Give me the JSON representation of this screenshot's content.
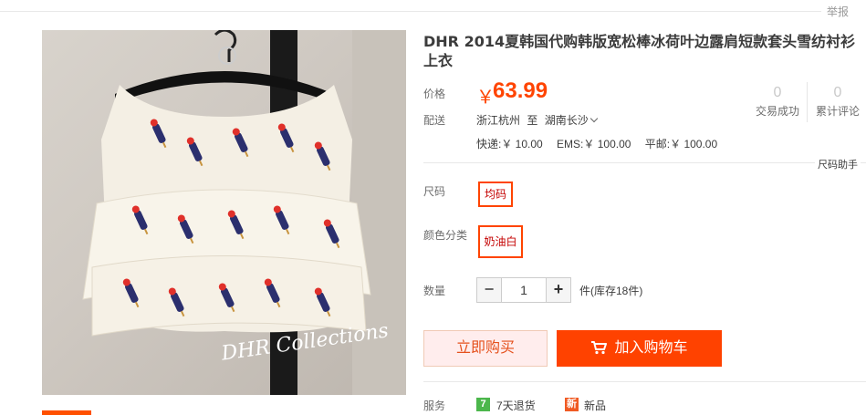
{
  "header": {
    "report_label": "举报"
  },
  "product": {
    "title": "DHR 2014夏韩国代购韩版宽松棒冰荷叶边露肩短款套头雪纺衬衫上衣",
    "image_logo_text": "DHR Collections"
  },
  "price": {
    "label": "价格",
    "symbol": "￥",
    "value": "63.99"
  },
  "stats": [
    {
      "count": "0",
      "label": "交易成功"
    },
    {
      "count": "0",
      "label": "累计评论"
    }
  ],
  "shipping": {
    "label": "配送",
    "from": "浙江杭州",
    "to_word": "至",
    "to": "湖南长沙",
    "fees": [
      "快递:￥ 10.00",
      "EMS:￥ 100.00",
      "平邮:￥ 100.00"
    ]
  },
  "size_help": "尺码助手",
  "size": {
    "label": "尺码",
    "selected": "均码"
  },
  "color": {
    "label": "颜色分类",
    "selected": "奶油白"
  },
  "quantity": {
    "label": "数量",
    "minus": "−",
    "value": "1",
    "plus": "+",
    "stock": "件(库存18件)"
  },
  "actions": {
    "buy_now": "立即购买",
    "add_to_cart": "加入购物车"
  },
  "services": {
    "label": "服务",
    "items": [
      {
        "badge": "7",
        "text": "7天退货",
        "color": "#4cb74c"
      },
      {
        "badge": "新",
        "text": "新品",
        "color": "#f05a23"
      }
    ]
  },
  "colors": {
    "accent": "#ff4400",
    "cart_button": "#ff4200",
    "buy_button_bg": "#ffeded"
  },
  "icons": [
    "cart-icon",
    "chevron-down-icon",
    "return-7day-icon",
    "new-item-icon"
  ]
}
